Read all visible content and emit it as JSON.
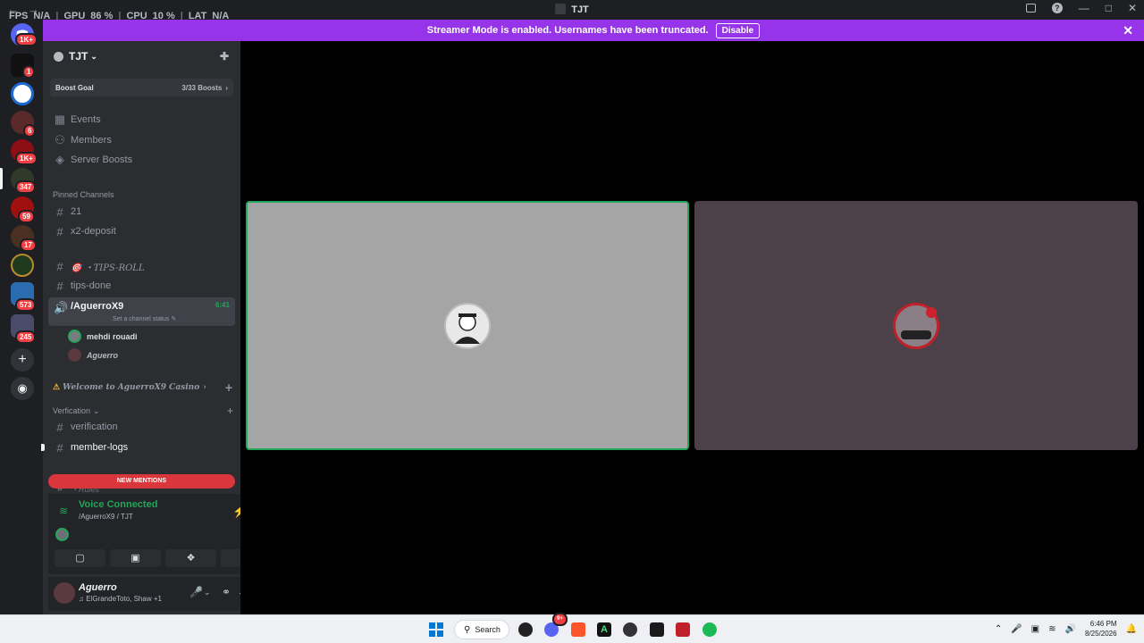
{
  "titlebar": {
    "title": "TJT",
    "overlay": {
      "fps_label": "FPS",
      "fps_value": "N/A",
      "gpu_label": "GPU",
      "gpu_value": "86 %",
      "cpu_label": "CPU",
      "cpu_value": "10 %",
      "lat_label": "LAT",
      "lat_value": "N/A"
    }
  },
  "banner": {
    "message": "Streamer Mode is enabled. Usernames have been truncated.",
    "button_label": "Disable",
    "close_icon": "close-icon"
  },
  "rail": {
    "badges": [
      "1K+",
      "1",
      "6",
      "1K+",
      "347",
      "59",
      "17",
      "573",
      "245"
    ],
    "icons": [
      "discord-home-icon",
      "add-server-icon",
      "explore-icon"
    ]
  },
  "server": {
    "name": "TJT",
    "boost_label": "Boost Goal",
    "boost_count": "3/33 Boosts"
  },
  "nav_items": [
    {
      "label": "Events",
      "icon": "calendar-icon"
    },
    {
      "label": "Members",
      "icon": "members-icon"
    },
    {
      "label": "Server Boosts",
      "icon": "boost-icon"
    }
  ],
  "pinned": {
    "heading": "Pinned Channels",
    "channels": [
      "21",
      "x2-deposit",
      "🎯 ・TIPS-ROLL",
      "tips-done"
    ]
  },
  "voice_channel": {
    "name": "/AguerroX9",
    "status": "Set a channel status",
    "duration": "6:41",
    "users": [
      "mehdi rouadi",
      "Aguerro"
    ]
  },
  "categories": {
    "welcome": "Welcome to AguerroX9 Casino",
    "verification": "Verfication"
  },
  "verification_channels": [
    "verification",
    "member-logs"
  ],
  "partial_channel": "・Rules",
  "mentions_label": "NEW MENTIONS",
  "voice_panel": {
    "status": "Voice Connected",
    "channel": "/AguerroX9 / TJT"
  },
  "user_panel": {
    "name": "Aguerro",
    "activity": "ElGrandeToto, Shaw +1"
  },
  "taskbar": {
    "search_label": "Search",
    "discord_badge": "9+",
    "time": "6:46 PM",
    "date": "8/25/2026"
  },
  "colors": {
    "banner": "#9534e8",
    "speaking": "#23a55a",
    "danger": "#da373c"
  }
}
